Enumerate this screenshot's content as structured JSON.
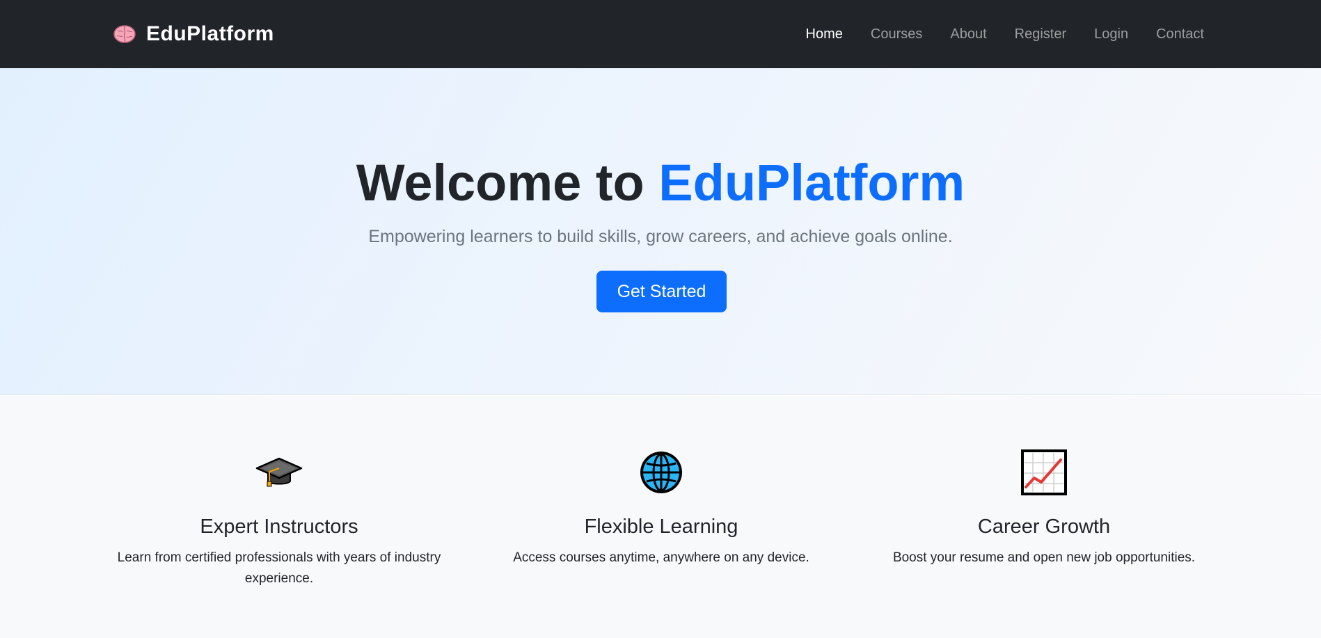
{
  "navbar": {
    "brand": "EduPlatform",
    "brand_icon": "brain-icon",
    "links": [
      {
        "label": "Home",
        "active": true
      },
      {
        "label": "Courses",
        "active": false
      },
      {
        "label": "About",
        "active": false
      },
      {
        "label": "Register",
        "active": false
      },
      {
        "label": "Login",
        "active": false
      },
      {
        "label": "Contact",
        "active": false
      }
    ]
  },
  "hero": {
    "title_prefix": "Welcome to ",
    "title_accent": "EduPlatform",
    "subtitle": "Empowering learners to build skills, grow careers, and achieve goals online.",
    "cta_label": "Get Started"
  },
  "features": [
    {
      "icon": "graduation-cap-icon",
      "title": "Expert Instructors",
      "description": "Learn from certified professionals with years of industry experience."
    },
    {
      "icon": "globe-icon",
      "title": "Flexible Learning",
      "description": "Access courses anytime, anywhere on any device."
    },
    {
      "icon": "chart-increasing-icon",
      "title": "Career Growth",
      "description": "Boost your resume and open new job opportunities."
    }
  ],
  "colors": {
    "navbar_bg": "#212529",
    "primary": "#0d6efd",
    "muted": "#6c757d",
    "features_bg": "#f8f9fa"
  }
}
